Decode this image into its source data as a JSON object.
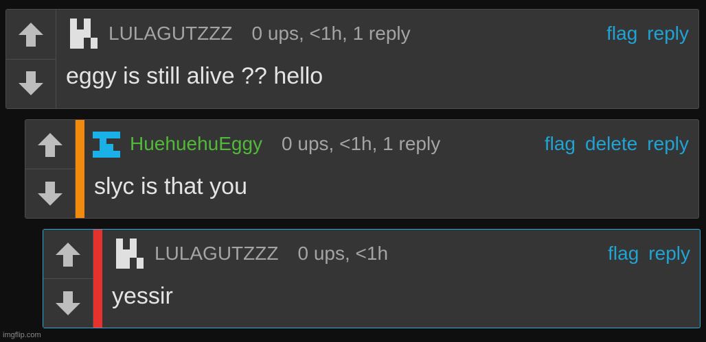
{
  "colors": {
    "background": "#0f0f0f",
    "card": "#353535",
    "link": "#21a3d3",
    "op_username": "#52b93a",
    "username": "#a4a4a4",
    "depth1_accent": "#f28a0e",
    "depth2_accent": "#e6322e",
    "selected_border": "#2ea7d9"
  },
  "comments": [
    {
      "username": "LULAGUTZZZ",
      "meta": "0 ups, <1h, 1 reply",
      "text": "eggy is still alive ?? hello",
      "avatar": "pixel-avatar-icon",
      "actions": {
        "flag": "flag",
        "reply": "reply"
      }
    },
    {
      "username": "HuehuehuEggy",
      "meta": "0 ups, <1h, 1 reply",
      "text": "slyc is that you",
      "avatar": "pixel-avatar-icon",
      "actions": {
        "flag": "flag",
        "delete": "delete",
        "reply": "reply"
      }
    },
    {
      "username": "LULAGUTZZZ",
      "meta": "0 ups, <1h",
      "text": "yessir",
      "avatar": "pixel-avatar-icon",
      "actions": {
        "flag": "flag",
        "reply": "reply"
      }
    }
  ],
  "watermark": "imgflip.com"
}
